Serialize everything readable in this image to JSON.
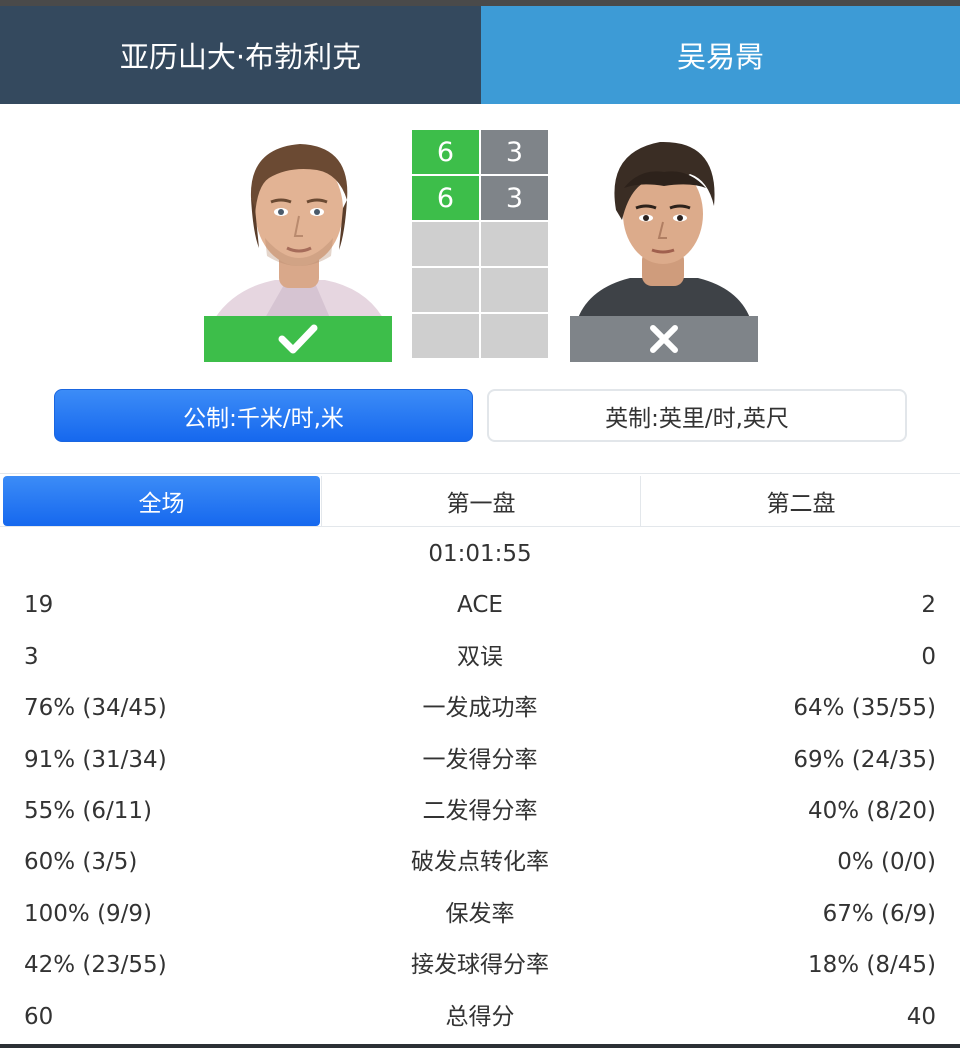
{
  "players": {
    "left": {
      "name": "亚历山大·布勃利克",
      "result": "win",
      "result_icon": "check-icon"
    },
    "right": {
      "name": "吴易昺",
      "result": "lose",
      "result_icon": "close-icon"
    }
  },
  "sets": [
    {
      "left": "6",
      "right": "3"
    },
    {
      "left": "6",
      "right": "3"
    },
    {
      "left": "",
      "right": ""
    },
    {
      "left": "",
      "right": ""
    },
    {
      "left": "",
      "right": ""
    }
  ],
  "units": {
    "metric": "公制:千米/时,米",
    "imperial": "英制:英里/时,英尺",
    "selected": "metric"
  },
  "tabs": {
    "items": [
      "全场",
      "第一盘",
      "第二盘"
    ],
    "selected": 0
  },
  "duration": "01:01:55",
  "stats": [
    {
      "left": "19",
      "label": "ACE",
      "right": "2"
    },
    {
      "left": "3",
      "label": "双误",
      "right": "0"
    },
    {
      "left": "76% (34/45)",
      "label": "一发成功率",
      "right": "64% (35/55)"
    },
    {
      "left": "91% (31/34)",
      "label": "一发得分率",
      "right": "69% (24/35)"
    },
    {
      "left": "55% (6/11)",
      "label": "二发得分率",
      "right": "40% (8/20)"
    },
    {
      "left": "60% (3/5)",
      "label": "破发点转化率",
      "right": "0% (0/0)"
    },
    {
      "left": "100% (9/9)",
      "label": "保发率",
      "right": "67% (6/9)"
    },
    {
      "left": "42% (23/55)",
      "label": "接发球得分率",
      "right": "18% (8/45)"
    },
    {
      "left": "60",
      "label": "总得分",
      "right": "40"
    }
  ],
  "colors": {
    "header_left": "#34495e",
    "header_right": "#3d9bd6",
    "win": "#3dbe4a",
    "lose": "#7f8489",
    "accent": "#1668ee"
  }
}
